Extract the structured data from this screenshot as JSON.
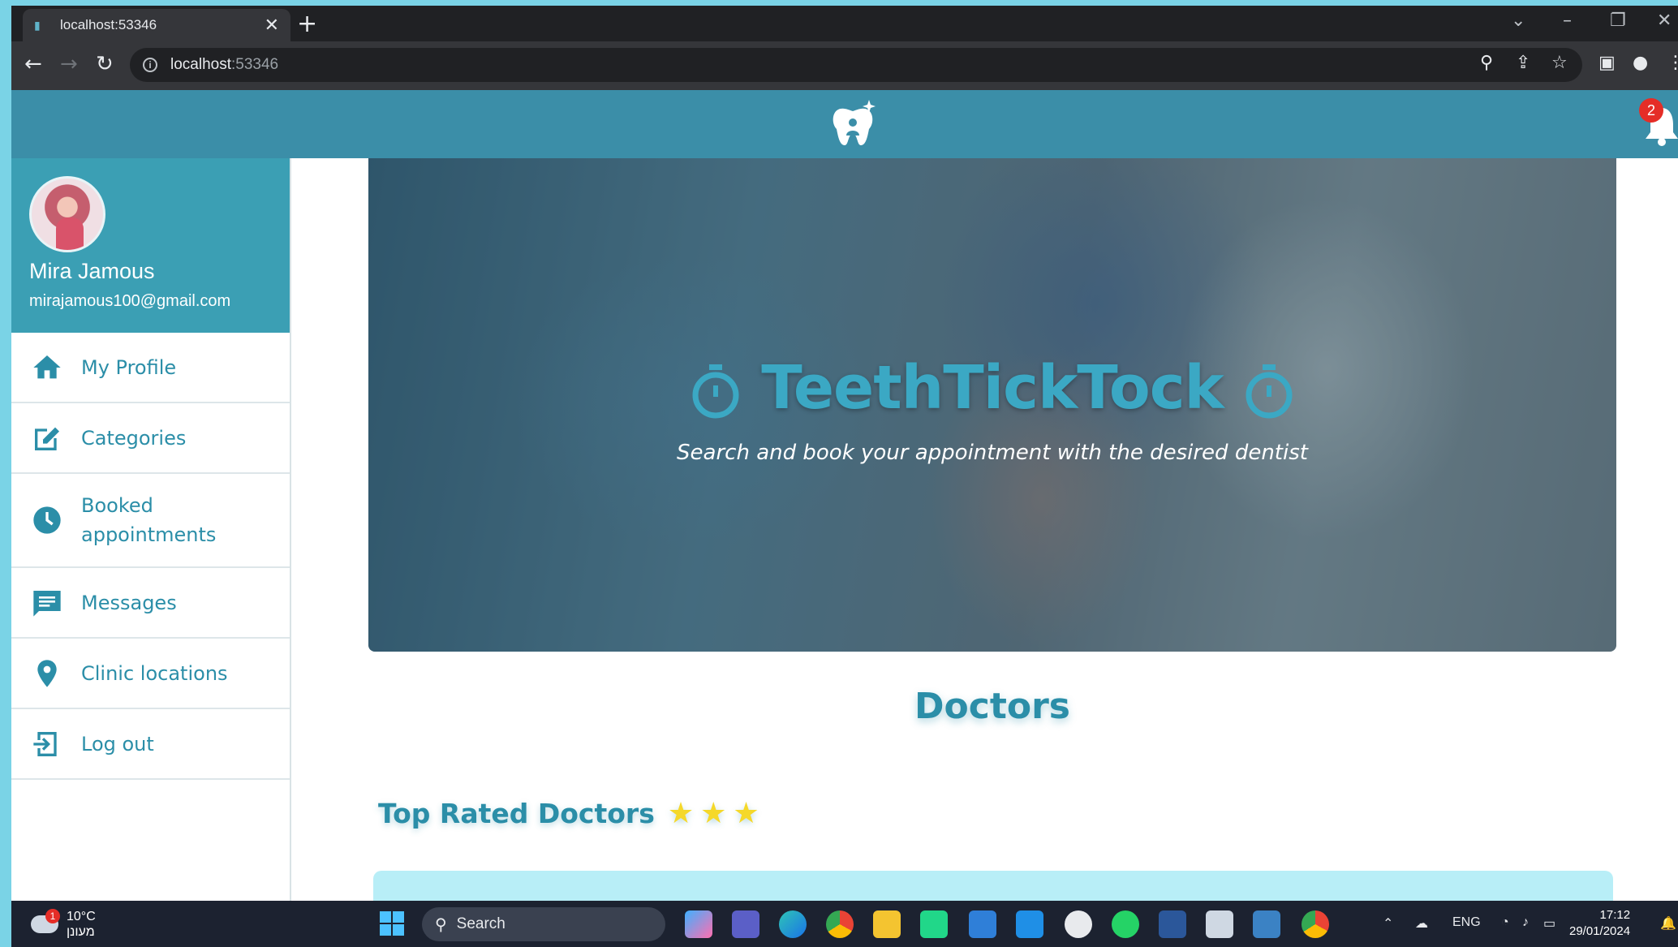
{
  "browser": {
    "tab_title": "localhost:53346",
    "close_glyph": "✕",
    "new_tab_glyph": "+",
    "url_host": "localhost",
    "url_port": ":53346"
  },
  "app": {
    "notification_count": "2",
    "brand_color": "#3b8ea8"
  },
  "sidebar": {
    "user_name": "Mira Jamous",
    "user_email": "mirajamous100@gmail.com",
    "items": [
      {
        "label": "My Profile",
        "icon": "home-icon"
      },
      {
        "label": "Categories",
        "icon": "edit-icon"
      },
      {
        "label": "Booked appointments",
        "icon": "clock-icon"
      },
      {
        "label": "Messages",
        "icon": "message-icon"
      },
      {
        "label": "Clinic locations",
        "icon": "location-pin-icon"
      },
      {
        "label": "Log out",
        "icon": "logout-icon"
      }
    ]
  },
  "hero": {
    "title": "TeethTickTock",
    "subtitle": "Search and book your appointment with the desired dentist"
  },
  "main": {
    "doctors_heading": "Doctors",
    "top_rated_heading": "Top Rated Doctors",
    "stars": "★★★"
  },
  "taskbar": {
    "weather_temp": "10°C",
    "weather_desc": "מעונן",
    "weather_badge": "1",
    "search_label": "Search",
    "lang": "ENG",
    "time": "17:12",
    "date": "29/01/2024"
  }
}
